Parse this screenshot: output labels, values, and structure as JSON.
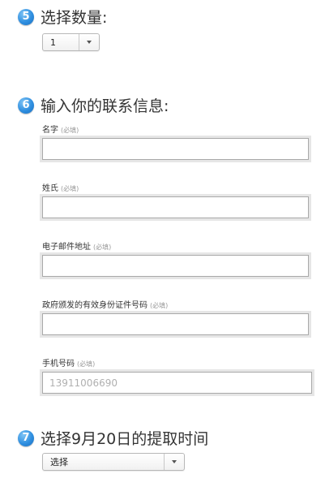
{
  "step5": {
    "number": "5",
    "title": "选择数量:",
    "quantity_select": {
      "value": "1"
    }
  },
  "step6": {
    "number": "6",
    "title": "输入你的联系信息:",
    "required_mark": "(必填)",
    "fields": [
      {
        "label": "名字",
        "value": "",
        "placeholder": ""
      },
      {
        "label": "姓氏",
        "value": "",
        "placeholder": ""
      },
      {
        "label": "电子邮件地址",
        "value": "",
        "placeholder": ""
      },
      {
        "label": "政府颁发的有效身份证件号码",
        "value": "",
        "placeholder": ""
      },
      {
        "label": "手机号码",
        "value": "",
        "placeholder": "13911006690"
      }
    ]
  },
  "step7": {
    "number": "7",
    "title": "选择9月20日的提取时间",
    "time_select": {
      "value": "选择"
    }
  }
}
